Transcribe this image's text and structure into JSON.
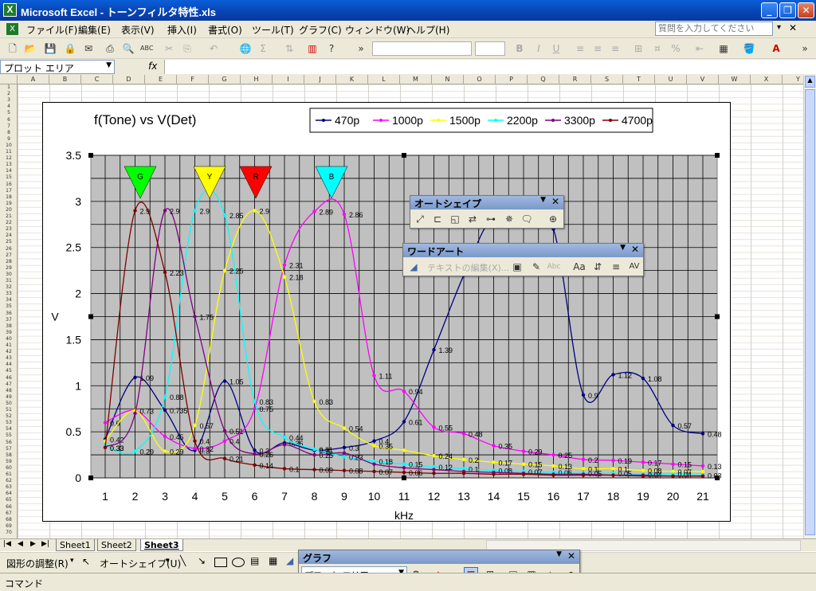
{
  "window": {
    "title": "Microsoft Excel - トーンフィルタ特性.xls",
    "logo_letter": "X"
  },
  "menu": {
    "items": [
      "ファイル(F)",
      "編集(E)",
      "表示(V)",
      "挿入(I)",
      "書式(O)",
      "ツール(T)",
      "グラフ(C)",
      "ウィンドウ(W)",
      "ヘルプ(H)"
    ],
    "help_placeholder": "質問を入力してください"
  },
  "namebox": {
    "value": "プロット エリア"
  },
  "formula": {
    "fx": "fx"
  },
  "columns": [
    "A",
    "B",
    "C",
    "D",
    "E",
    "F",
    "G",
    "H",
    "I",
    "J",
    "K",
    "L",
    "M",
    "N",
    "O",
    "P",
    "Q",
    "R",
    "S",
    "T",
    "U",
    "V",
    "W",
    "X",
    "Y"
  ],
  "sheets": [
    "Sheet1",
    "Sheet2",
    "Sheet3"
  ],
  "drawing": {
    "adjust": "図形の調整(R)",
    "autoshape": "オートシェイプ(U)"
  },
  "status": {
    "text": "コマンド"
  },
  "autoshape_toolbar": {
    "title": "オートシェイプ"
  },
  "wordart_toolbar": {
    "title": "ワードアート",
    "edit_text": "テキストの編集(X)...",
    "abc": "Abc"
  },
  "chart_toolbar": {
    "title": "グラフ",
    "selected": "プロット エリア"
  },
  "markers": [
    {
      "label": "G",
      "color": "#00ff00"
    },
    {
      "label": "Y",
      "color": "#ffff00"
    },
    {
      "label": "R",
      "color": "#ff0000"
    },
    {
      "label": "B",
      "color": "#00ffff"
    }
  ],
  "chart_data": {
    "type": "line",
    "title": "f(Tone) vs V(Det)",
    "xlabel": "kHz",
    "ylabel": "V",
    "ylim": [
      0,
      3.5
    ],
    "ytick_step": 0.5,
    "plot_bg": "#c0c0c0",
    "x": [
      1,
      2,
      3,
      4,
      5,
      6,
      7,
      8,
      9,
      10,
      11,
      12,
      13,
      14,
      15,
      16,
      17,
      18,
      19,
      20,
      21
    ],
    "series": [
      {
        "name": "470p",
        "color": "#000080",
        "values": [
          0.42,
          1.09,
          0.735,
          0.3,
          1.05,
          0.3,
          0.38,
          0.3,
          0.33,
          0.4,
          0.61,
          1.39,
          2.2,
          2.85,
          2.8,
          2.7,
          0.9,
          1.12,
          1.08,
          0.57,
          0.48
        ],
        "labels": [
          "0.42",
          "1.09",
          "0.735",
          "0.3",
          "1.05",
          "0.3",
          "0.36",
          "0.3",
          "0.3",
          "0.4",
          "0.61",
          "1.39",
          "",
          "",
          "",
          "",
          "0.9",
          "1.12",
          "1.08",
          "0.57",
          "0.48"
        ]
      },
      {
        "name": "1000p",
        "color": "#ff00ff",
        "values": [
          0.6,
          0.73,
          0.45,
          0.32,
          0.4,
          0.75,
          2.31,
          2.89,
          2.86,
          1.11,
          0.94,
          0.55,
          0.48,
          0.35,
          0.29,
          0.25,
          0.2,
          0.19,
          0.17,
          0.15,
          0.13
        ],
        "labels": [
          "0.6",
          "0.73",
          "0.45",
          "0.32",
          "0.4",
          "0.75",
          "2.31",
          "2.89",
          "2.86",
          "1.11",
          "0.94",
          "0.55",
          "0.48",
          "0.35",
          "0.29",
          "0.25",
          "0.2",
          "0.19",
          "0.17",
          "0.15",
          "0.13"
        ]
      },
      {
        "name": "1500p",
        "color": "#ffff00",
        "values": [
          0.4,
          0.73,
          0.29,
          0.57,
          2.25,
          2.9,
          2.18,
          0.83,
          0.54,
          0.35,
          0.3,
          0.24,
          0.2,
          0.17,
          0.15,
          0.13,
          0.1,
          0.1,
          0.08,
          0.07,
          0.07
        ],
        "labels": [
          "",
          "",
          "0.29",
          "0.57",
          "2.25",
          "2.9",
          "2.18",
          "0.83",
          "0.54",
          "0.35",
          "",
          "0.24",
          "0.2",
          "0.17",
          "0.15",
          "0.13",
          "0.1",
          "0.1",
          "0.08",
          "0.07",
          ""
        ]
      },
      {
        "name": "2200p",
        "color": "#00ffff",
        "values": [
          0.35,
          0.29,
          0.88,
          2.9,
          2.85,
          0.83,
          0.44,
          0.31,
          0.23,
          0.18,
          0.15,
          0.12,
          0.1,
          0.08,
          0.07,
          0.06,
          0.05,
          0.05,
          0.04,
          0.04,
          0.03
        ],
        "labels": [
          "",
          "0.29",
          "0.88",
          "2.9",
          "2.85",
          "0.83",
          "0.44",
          "0.31",
          "0.23",
          "0.18",
          "0.15",
          "0.12",
          "0.1",
          "0.08",
          "0.07",
          "0.06",
          "0.05",
          "0.05",
          "0.04",
          "0.04",
          "0.03"
        ]
      },
      {
        "name": "3300p",
        "color": "#800080",
        "values": [
          0.33,
          0.7,
          2.9,
          1.75,
          0.51,
          0.26,
          0.36,
          0.25,
          0.27,
          0.15,
          0.11,
          0.09,
          0.07,
          0.06,
          0.05,
          0.04,
          0.04,
          0.03,
          0.03,
          0.02,
          0.02
        ],
        "labels": [
          "0.33",
          "",
          "2.9",
          "1.75",
          "0.51",
          "0.26",
          "",
          "0.25",
          "",
          "",
          "",
          "",
          "",
          "",
          "",
          "",
          "",
          "",
          "",
          "",
          ""
        ]
      },
      {
        "name": "4700p",
        "color": "#800000",
        "values": [
          0.33,
          2.9,
          2.23,
          0.4,
          0.21,
          0.14,
          0.1,
          0.09,
          0.08,
          0.07,
          0.06,
          0.05,
          0.05,
          0.04,
          0.04,
          0.03,
          0.03,
          0.03,
          0.02,
          0.02,
          0.02
        ],
        "labels": [
          "0.33",
          "2.9",
          "2.23",
          "0.4",
          "0.21",
          "0.14",
          "0.1",
          "0.09",
          "0.08",
          "0.07",
          "0.06",
          "",
          "",
          "",
          "",
          "",
          "",
          "",
          "",
          "",
          ""
        ]
      }
    ]
  }
}
